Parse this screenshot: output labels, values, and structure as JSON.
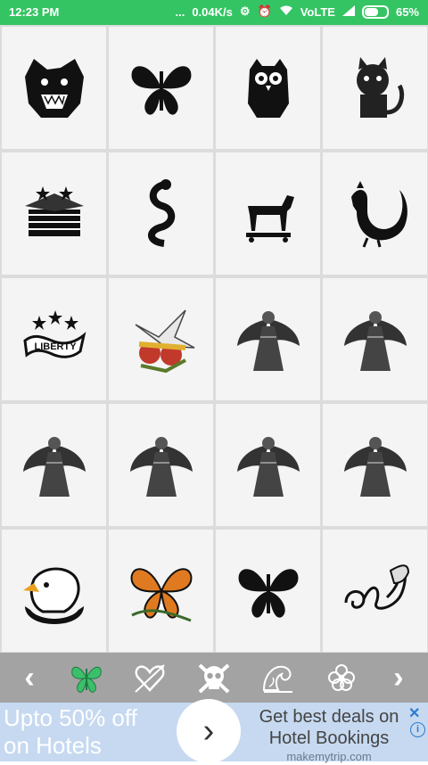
{
  "status_bar": {
    "time": "12:23 PM",
    "dots": "...",
    "speed": "0.04K/s",
    "network": "VoLTE",
    "battery": "65%"
  },
  "grid": {
    "tiles": [
      {
        "name": "panther-head",
        "icon": "panther-icon"
      },
      {
        "name": "butterfly",
        "icon": "butterfly-icon"
      },
      {
        "name": "owl",
        "icon": "owl-icon"
      },
      {
        "name": "sailor-cat",
        "icon": "cat-icon"
      },
      {
        "name": "eagle-flag",
        "icon": "eagle-flag-icon"
      },
      {
        "name": "snake",
        "icon": "snake-icon"
      },
      {
        "name": "horse-toy",
        "icon": "horse-icon"
      },
      {
        "name": "rooster",
        "icon": "rooster-icon"
      },
      {
        "name": "liberty-banner",
        "icon": "banner-icon",
        "text": "LIBERTY"
      },
      {
        "name": "swallows-roses",
        "icon": "swallow-icon"
      },
      {
        "name": "winged-woman",
        "icon": "angel-icon"
      },
      {
        "name": "angel-statue",
        "icon": "angel-icon"
      },
      {
        "name": "angel-warrior",
        "icon": "angel-icon"
      },
      {
        "name": "angel-bride",
        "icon": "angel-icon"
      },
      {
        "name": "angel-halo",
        "icon": "angel-icon"
      },
      {
        "name": "angel-praying",
        "icon": "angel-icon"
      },
      {
        "name": "eagle-head",
        "icon": "eagle-icon"
      },
      {
        "name": "monarch-butterfly",
        "icon": "butterfly-icon"
      },
      {
        "name": "tribal-butterfly",
        "icon": "butterfly-icon"
      },
      {
        "name": "tribal-swirl",
        "icon": "swirl-icon"
      }
    ]
  },
  "category_bar": {
    "prev": "‹",
    "next": "›",
    "categories": [
      {
        "name": "butterfly",
        "icon": "butterfly-icon",
        "selected": true,
        "color": "#3bbf6a"
      },
      {
        "name": "heart",
        "icon": "heart-arrow-icon",
        "selected": false,
        "color": "#ffffff"
      },
      {
        "name": "skull",
        "icon": "skull-icon",
        "selected": false,
        "color": "#ffffff"
      },
      {
        "name": "wave",
        "icon": "wave-icon",
        "selected": false,
        "color": "#ffffff"
      },
      {
        "name": "flower",
        "icon": "flower-icon",
        "selected": false,
        "color": "#ffffff"
      }
    ]
  },
  "ad": {
    "left_line1": "Upto 50% off",
    "left_line2": "on Hotels",
    "button": "›",
    "right_line1": "Get best deals on",
    "right_line2": "Hotel Bookings",
    "url": "makemytrip.com",
    "close": "✕",
    "info": "i"
  },
  "colors": {
    "status_bar": "#35c463",
    "category_bar": "#a3a3a3",
    "ad_bg": "#c6d9f0",
    "selected_category": "#3bbf6a"
  }
}
